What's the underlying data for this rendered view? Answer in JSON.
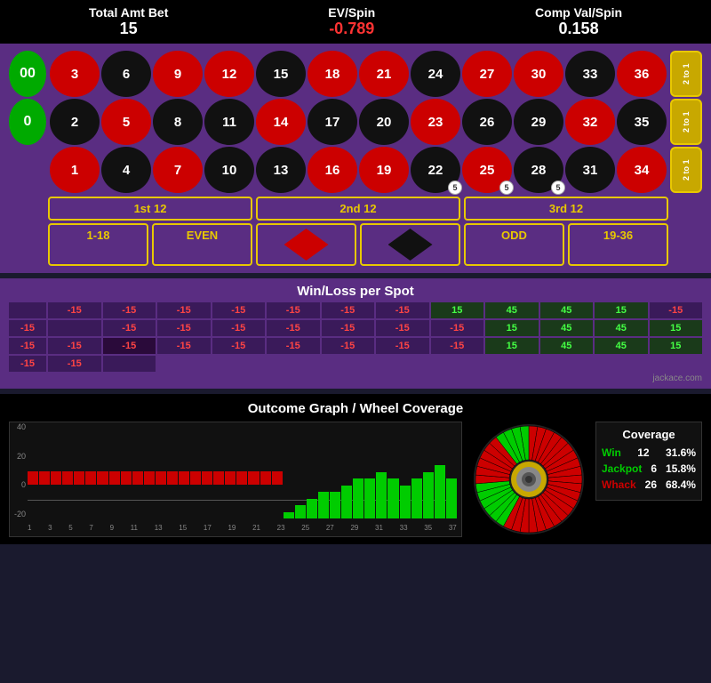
{
  "header": {
    "total_amt_bet_label": "Total Amt Bet",
    "total_amt_bet_value": "15",
    "ev_spin_label": "EV/Spin",
    "ev_spin_value": "-0.789",
    "comp_val_spin_label": "Comp Val/Spin",
    "comp_val_spin_value": "0.158"
  },
  "table": {
    "zeros": [
      "00",
      "0"
    ],
    "col2to1": [
      "2 to 1",
      "2 to 1",
      "2 to 1"
    ],
    "numbers": [
      {
        "n": "3",
        "c": "red"
      },
      {
        "n": "6",
        "c": "black"
      },
      {
        "n": "9",
        "c": "red"
      },
      {
        "n": "12",
        "c": "red"
      },
      {
        "n": "15",
        "c": "black"
      },
      {
        "n": "18",
        "c": "red"
      },
      {
        "n": "21",
        "c": "red"
      },
      {
        "n": "24",
        "c": "black"
      },
      {
        "n": "27",
        "c": "red"
      },
      {
        "n": "30",
        "c": "red"
      },
      {
        "n": "33",
        "c": "black"
      },
      {
        "n": "36",
        "c": "red"
      },
      {
        "n": "2",
        "c": "black"
      },
      {
        "n": "5",
        "c": "red"
      },
      {
        "n": "8",
        "c": "black"
      },
      {
        "n": "11",
        "c": "black"
      },
      {
        "n": "14",
        "c": "red"
      },
      {
        "n": "17",
        "c": "black"
      },
      {
        "n": "20",
        "c": "black"
      },
      {
        "n": "23",
        "c": "red"
      },
      {
        "n": "26",
        "c": "black"
      },
      {
        "n": "29",
        "c": "black"
      },
      {
        "n": "32",
        "c": "red"
      },
      {
        "n": "35",
        "c": "black"
      },
      {
        "n": "1",
        "c": "red"
      },
      {
        "n": "4",
        "c": "black"
      },
      {
        "n": "7",
        "c": "red"
      },
      {
        "n": "10",
        "c": "black"
      },
      {
        "n": "13",
        "c": "black"
      },
      {
        "n": "16",
        "c": "red"
      },
      {
        "n": "19",
        "c": "red"
      },
      {
        "n": "22",
        "c": "black"
      },
      {
        "n": "25",
        "c": "red",
        "chip": 5
      },
      {
        "n": "28",
        "c": "black",
        "chip": 5
      },
      {
        "n": "31",
        "c": "black"
      },
      {
        "n": "34",
        "c": "red"
      }
    ],
    "chips": {
      "22": "5",
      "25": "5",
      "28": "5"
    },
    "dozens": [
      "1st 12",
      "2nd 12",
      "3rd 12"
    ],
    "outside": [
      "1-18",
      "EVEN",
      "",
      "",
      "ODD",
      "19-36"
    ]
  },
  "winloss": {
    "title": "Win/Loss per Spot",
    "rows": [
      {
        "left": null,
        "cells": [
          "-15",
          "-15",
          "-15",
          "-15",
          "-15",
          "-15",
          "-15",
          "15",
          "45",
          "45",
          "15",
          "-15",
          "-15"
        ]
      },
      {
        "left": null,
        "cells": [
          "-15",
          "-15",
          "-15",
          "-15",
          "-15",
          "-15",
          "-15",
          "15",
          "45",
          "45",
          "15",
          "-15",
          "-15"
        ]
      },
      {
        "left": "-15",
        "cells": [
          "-15",
          "-15",
          "-15",
          "-15",
          "-15",
          "-15",
          "15",
          "45",
          "45",
          "15",
          "-15",
          "-15",
          ""
        ]
      }
    ],
    "credit": "jackace.com"
  },
  "outcome": {
    "title": "Outcome Graph / Wheel Coverage",
    "y_labels": [
      "40",
      "20",
      "0",
      "-20"
    ],
    "x_labels": [
      "1",
      "3",
      "5",
      "7",
      "9",
      "11",
      "13",
      "15",
      "17",
      "19",
      "21",
      "23",
      "25",
      "27",
      "29",
      "31",
      "33",
      "35",
      "37"
    ],
    "bars": [
      {
        "v": -1,
        "c": "red"
      },
      {
        "v": -1,
        "c": "red"
      },
      {
        "v": -1,
        "c": "red"
      },
      {
        "v": -1,
        "c": "red"
      },
      {
        "v": -1,
        "c": "red"
      },
      {
        "v": -1,
        "c": "red"
      },
      {
        "v": -1,
        "c": "red"
      },
      {
        "v": -1,
        "c": "red"
      },
      {
        "v": -1,
        "c": "red"
      },
      {
        "v": -1,
        "c": "red"
      },
      {
        "v": -1,
        "c": "red"
      },
      {
        "v": -1,
        "c": "red"
      },
      {
        "v": -1,
        "c": "red"
      },
      {
        "v": -1,
        "c": "red"
      },
      {
        "v": -1,
        "c": "red"
      },
      {
        "v": -1,
        "c": "red"
      },
      {
        "v": -1,
        "c": "red"
      },
      {
        "v": -1,
        "c": "red"
      },
      {
        "v": -1,
        "c": "red"
      },
      {
        "v": -1,
        "c": "red"
      },
      {
        "v": -1,
        "c": "red"
      },
      {
        "v": -1,
        "c": "red"
      },
      {
        "v": 0.5,
        "c": "green"
      },
      {
        "v": 1,
        "c": "green"
      },
      {
        "v": 1.5,
        "c": "green"
      },
      {
        "v": 2,
        "c": "green"
      },
      {
        "v": 2,
        "c": "green"
      },
      {
        "v": 2.5,
        "c": "green"
      },
      {
        "v": 3,
        "c": "green"
      },
      {
        "v": 3,
        "c": "green"
      },
      {
        "v": 3.5,
        "c": "green"
      },
      {
        "v": 3,
        "c": "green"
      },
      {
        "v": 2.5,
        "c": "green"
      },
      {
        "v": 3,
        "c": "green"
      },
      {
        "v": 3.5,
        "c": "green"
      },
      {
        "v": 4,
        "c": "green"
      },
      {
        "v": 3,
        "c": "green"
      }
    ],
    "coverage": {
      "title": "Coverage",
      "win_label": "Win",
      "win_count": "12",
      "win_pct": "31.6%",
      "jackpot_label": "Jackpot",
      "jackpot_count": "6",
      "jackpot_pct": "15.8%",
      "whack_label": "Whack",
      "whack_count": "26",
      "whack_pct": "68.4%"
    }
  }
}
